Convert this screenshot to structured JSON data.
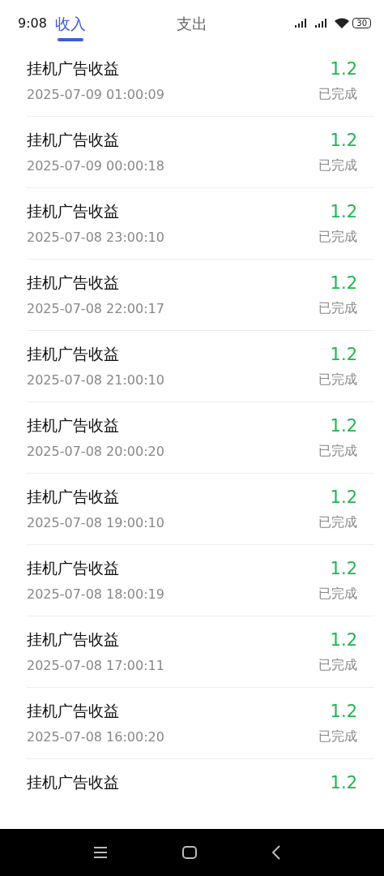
{
  "status_bar": {
    "time": "9:08",
    "battery": "30"
  },
  "tabs": [
    {
      "label": "收入",
      "selected": true
    },
    {
      "label": "支出",
      "selected": false
    }
  ],
  "records": [
    {
      "title": "挂机广告收益",
      "time": "2025-07-09 01:00:09",
      "amount": "1.2",
      "status": "已完成"
    },
    {
      "title": "挂机广告收益",
      "time": "2025-07-09 00:00:18",
      "amount": "1.2",
      "status": "已完成"
    },
    {
      "title": "挂机广告收益",
      "time": "2025-07-08 23:00:10",
      "amount": "1.2",
      "status": "已完成"
    },
    {
      "title": "挂机广告收益",
      "time": "2025-07-08 22:00:17",
      "amount": "1.2",
      "status": "已完成"
    },
    {
      "title": "挂机广告收益",
      "time": "2025-07-08 21:00:10",
      "amount": "1.2",
      "status": "已完成"
    },
    {
      "title": "挂机广告收益",
      "time": "2025-07-08 20:00:20",
      "amount": "1.2",
      "status": "已完成"
    },
    {
      "title": "挂机广告收益",
      "time": "2025-07-08 19:00:10",
      "amount": "1.2",
      "status": "已完成"
    },
    {
      "title": "挂机广告收益",
      "time": "2025-07-08 18:00:19",
      "amount": "1.2",
      "status": "已完成"
    },
    {
      "title": "挂机广告收益",
      "time": "2025-07-08 17:00:11",
      "amount": "1.2",
      "status": "已完成"
    },
    {
      "title": "挂机广告收益",
      "time": "2025-07-08 16:00:20",
      "amount": "1.2",
      "status": "已完成"
    },
    {
      "title": "挂机广告收益",
      "amount": "1.2"
    }
  ]
}
